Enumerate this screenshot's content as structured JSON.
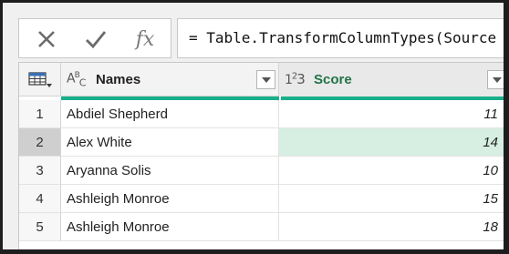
{
  "formula_bar": {
    "cancel_icon": "x-icon",
    "accept_icon": "checkmark-icon",
    "fx_label": "fx",
    "formula": "= Table.TransformColumnTypes(Source"
  },
  "grid": {
    "corner_icon": "table-icon",
    "columns": [
      {
        "type_icon": "ABC",
        "label": "Names"
      },
      {
        "type_icon": "123",
        "label": "Score"
      }
    ],
    "quality_color": "#1aaf8b",
    "rows": [
      {
        "n": "1",
        "name": "Abdiel Shepherd",
        "score": "11"
      },
      {
        "n": "2",
        "name": "Alex White",
        "score": "14"
      },
      {
        "n": "3",
        "name": "Aryanna Solis",
        "score": "10"
      },
      {
        "n": "4",
        "name": "Ashleigh Monroe",
        "score": "15"
      },
      {
        "n": "5",
        "name": "Ashleigh Monroe",
        "score": "18"
      }
    ]
  }
}
